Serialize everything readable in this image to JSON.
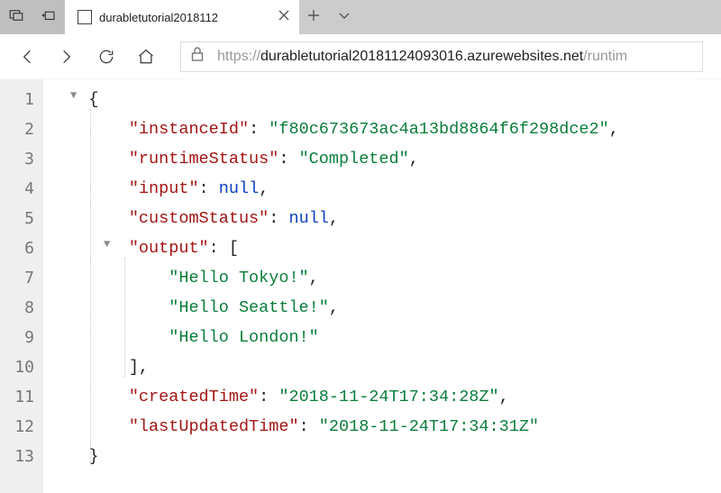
{
  "tab": {
    "title": "durabletutorial2018112"
  },
  "url": {
    "scheme": "https://",
    "host": "durabletutorial20181124093016.azurewebsites.net",
    "path": "/runtim"
  },
  "json": {
    "instanceId_key": "\"instanceId\"",
    "instanceId_val": "\"f80c673673ac4a13bd8864f6f298dce2\"",
    "runtimeStatus_key": "\"runtimeStatus\"",
    "runtimeStatus_val": "\"Completed\"",
    "input_key": "\"input\"",
    "input_val": "null",
    "customStatus_key": "\"customStatus\"",
    "customStatus_val": "null",
    "output_key": "\"output\"",
    "output_0": "\"Hello Tokyo!\"",
    "output_1": "\"Hello Seattle!\"",
    "output_2": "\"Hello London!\"",
    "createdTime_key": "\"createdTime\"",
    "createdTime_val": "\"2018-11-24T17:34:28Z\"",
    "lastUpdatedTime_key": "\"lastUpdatedTime\"",
    "lastUpdatedTime_val": "\"2018-11-24T17:34:31Z\""
  },
  "lines": [
    "1",
    "2",
    "3",
    "4",
    "5",
    "6",
    "7",
    "8",
    "9",
    "10",
    "11",
    "12",
    "13"
  ]
}
